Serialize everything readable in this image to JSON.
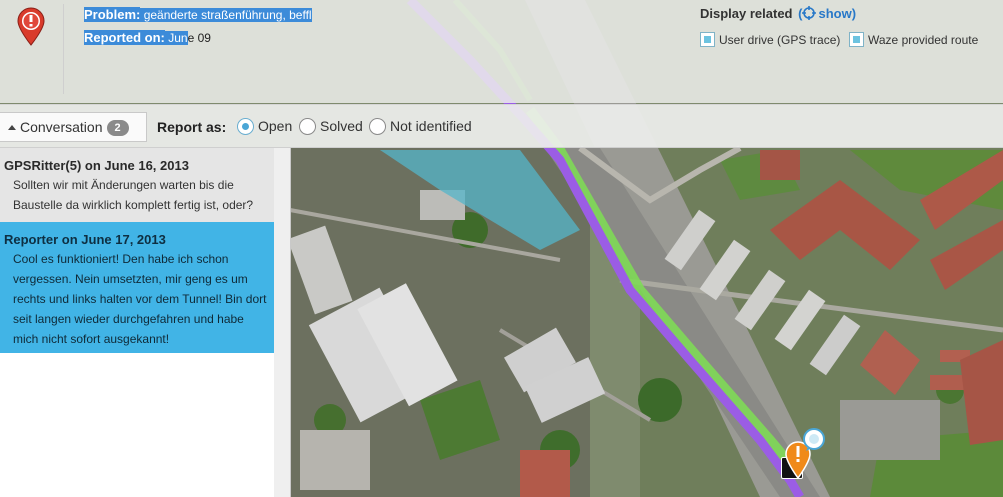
{
  "problem": {
    "label": "Problem:",
    "value": "geänderte straßenführung, beffl"
  },
  "reported": {
    "label": "Reported on:",
    "value_highlighted": "Jun",
    "value_rest": "e 09"
  },
  "display_related": {
    "label": "Display related",
    "show_label": "show",
    "options": [
      {
        "label": "User drive (GPS trace)",
        "checked": true
      },
      {
        "label": "Waze provided route",
        "checked": true
      }
    ]
  },
  "toolbar": {
    "conversation_label": "Conversation",
    "conversation_count": "2",
    "report_as_label": "Report as:",
    "status_options": [
      {
        "label": "Open",
        "selected": true
      },
      {
        "label": "Solved",
        "selected": false
      },
      {
        "label": "Not identified",
        "selected": false
      }
    ]
  },
  "conversation": {
    "messages": [
      {
        "author": "GPSRitter(5) on June 16, 2013",
        "text": "Sollten wir mit Änderungen warten bis die Baustelle da wirklich komplett fertig ist, oder?"
      },
      {
        "author": "Reporter on June 17, 2013",
        "text": "Cool es funktioniert! Den habe ich schon vergessen. Nein umsetzten, mir geng es um rechts und links halten vor dem Tunnel! Bin dort seit langen wieder durchgefahren und habe mich nicht sofort ausgekannt!"
      }
    ]
  },
  "colors": {
    "highlight": "#3c8bd9",
    "selected_message": "#41b4e6",
    "gps_trace": "#9b5de5",
    "waze_route": "#7ed957",
    "alert_red": "#d93b2b",
    "warning_orange": "#f08a1a"
  },
  "icons": {
    "alert": "alert-pin-icon",
    "show": "crosshair-icon",
    "warning": "warning-pin-icon",
    "chat": "chat-bubble-icon"
  }
}
